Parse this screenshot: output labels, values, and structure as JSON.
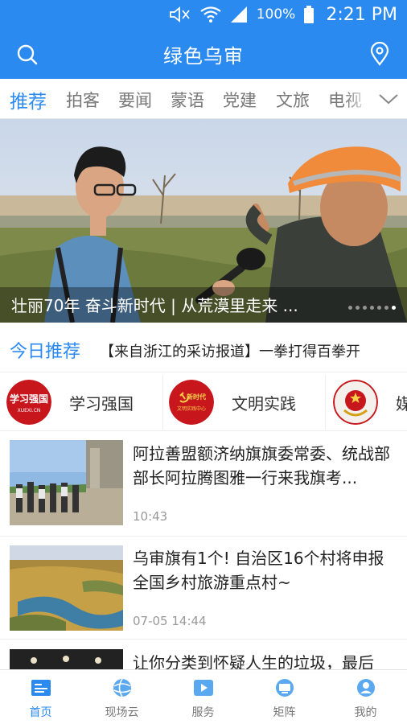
{
  "status_bar": {
    "battery_percent": "100%",
    "time": "2:21 PM",
    "icons": [
      "mute-icon",
      "wifi-icon",
      "signal-icon",
      "battery-icon"
    ]
  },
  "header": {
    "title": "绿色乌审",
    "left_icon": "search-icon",
    "right_icon": "location-pin-icon"
  },
  "tabs": {
    "items": [
      {
        "label": "推荐",
        "active": true
      },
      {
        "label": "拍客"
      },
      {
        "label": "要闻"
      },
      {
        "label": "蒙语"
      },
      {
        "label": "党建"
      },
      {
        "label": "文旅"
      },
      {
        "label": "电视"
      }
    ],
    "more_icon": "chevron-down-icon"
  },
  "banner": {
    "caption": "壮丽70年 奋斗新时代 | 从荒漠里走来 ...",
    "slide_count": 7,
    "active_slide": 7
  },
  "today": {
    "label": "今日推荐",
    "headline": "【来自浙江的采访报道】一拳打得百拳开"
  },
  "shortcuts": [
    {
      "label": "学习强国",
      "logo_text": "学习强国",
      "logo_sub": "XUEXI.CN"
    },
    {
      "label": "文明实践",
      "logo_text": "新时代",
      "logo_sub": "文明实践中心"
    },
    {
      "label": "媒",
      "logo_text": "",
      "logo_sub": ""
    }
  ],
  "news": [
    {
      "title": "阿拉善盟额济纳旗旗委常委、统战部部长阿拉腾图雅一行来我旗考...",
      "time": "10:43"
    },
    {
      "title": "乌审旗有1个! 自治区16个村将申报全国乡村旅游重点村~",
      "time": "07-05 14:44"
    },
    {
      "title": "让你分类到怀疑人生的垃圾，最后",
      "time": ""
    }
  ],
  "bottom_nav": [
    {
      "label": "首页",
      "icon": "home-news-icon",
      "active": true
    },
    {
      "label": "现场云",
      "icon": "live-cloud-icon"
    },
    {
      "label": "服务",
      "icon": "service-play-icon"
    },
    {
      "label": "矩阵",
      "icon": "matrix-tv-icon"
    },
    {
      "label": "我的",
      "icon": "profile-icon"
    }
  ],
  "colors": {
    "brand_blue": "#2a8af0",
    "inactive_text": "#777777",
    "logo_red": "#c8161d"
  }
}
